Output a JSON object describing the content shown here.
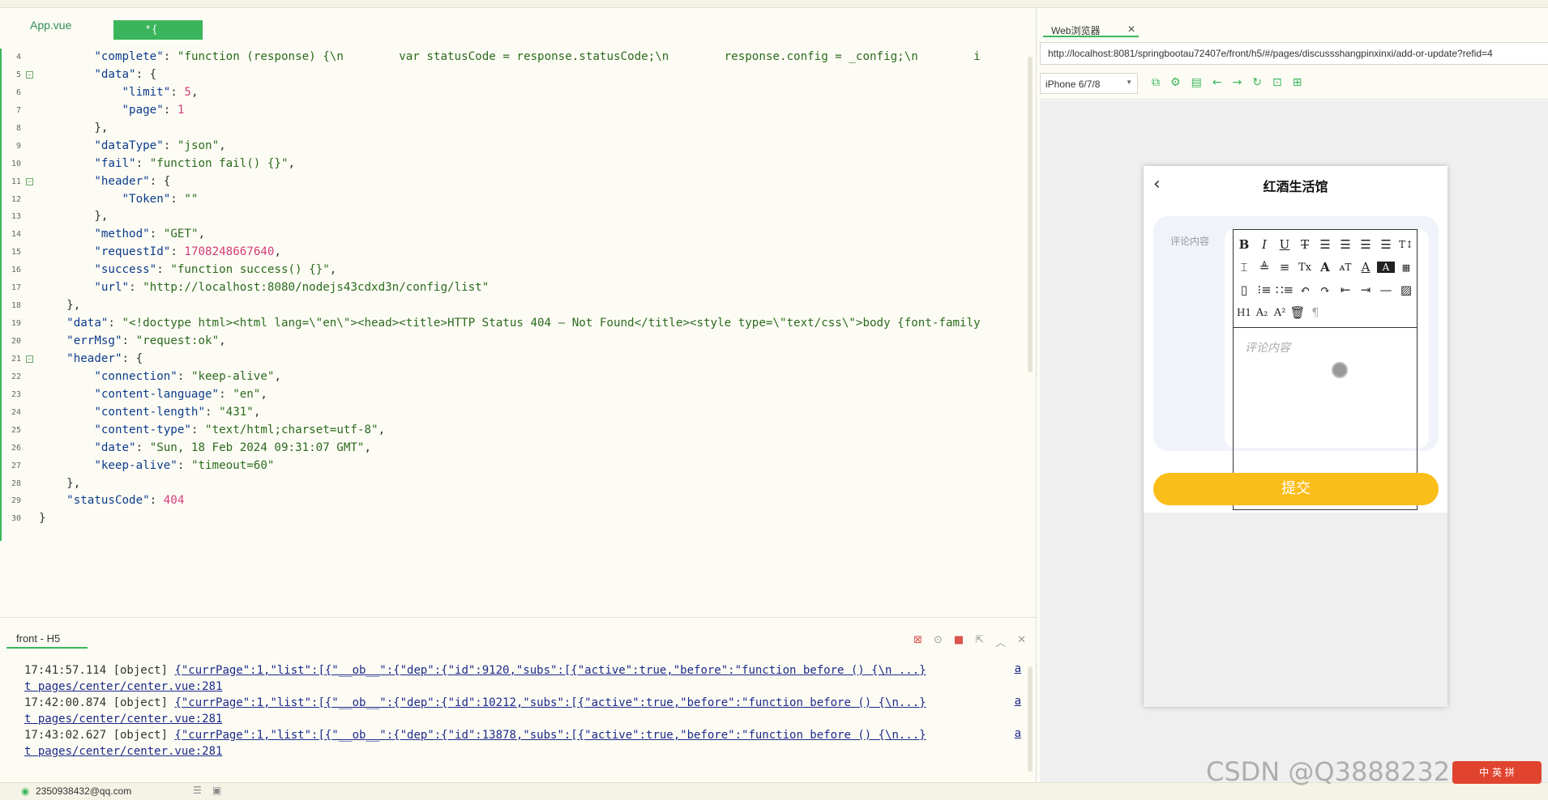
{
  "tabs": {
    "file1": "App.vue",
    "file2": "* {"
  },
  "code": [
    {
      "n": "4",
      "fold": false,
      "parts": [
        [
          "",
          "        "
        ],
        [
          "k",
          "\"complete\""
        ],
        [
          "",
          ": "
        ],
        [
          "s",
          "\"function (response) {\\n        var statusCode = response.statusCode;\\n        response.config = _config;\\n        i"
        ]
      ]
    },
    {
      "n": "5",
      "fold": true,
      "parts": [
        [
          "",
          "        "
        ],
        [
          "k",
          "\"data\""
        ],
        [
          "",
          ": {"
        ]
      ]
    },
    {
      "n": "6",
      "fold": false,
      "parts": [
        [
          "",
          "            "
        ],
        [
          "k",
          "\"limit\""
        ],
        [
          "",
          ": "
        ],
        [
          "n",
          "5"
        ],
        [
          "",
          ","
        ]
      ]
    },
    {
      "n": "7",
      "fold": false,
      "parts": [
        [
          "",
          "            "
        ],
        [
          "k",
          "\"page\""
        ],
        [
          "",
          ": "
        ],
        [
          "n",
          "1"
        ]
      ]
    },
    {
      "n": "8",
      "fold": false,
      "parts": [
        [
          "",
          "        },"
        ]
      ]
    },
    {
      "n": "9",
      "fold": false,
      "parts": [
        [
          "",
          "        "
        ],
        [
          "k",
          "\"dataType\""
        ],
        [
          "",
          ": "
        ],
        [
          "s",
          "\"json\""
        ],
        [
          "",
          ","
        ]
      ]
    },
    {
      "n": "10",
      "fold": false,
      "parts": [
        [
          "",
          "        "
        ],
        [
          "k",
          "\"fail\""
        ],
        [
          "",
          ": "
        ],
        [
          "s",
          "\"function fail() {}\""
        ],
        [
          "",
          ","
        ]
      ]
    },
    {
      "n": "11",
      "fold": true,
      "parts": [
        [
          "",
          "        "
        ],
        [
          "k",
          "\"header\""
        ],
        [
          "",
          ": {"
        ]
      ]
    },
    {
      "n": "12",
      "fold": false,
      "parts": [
        [
          "",
          "            "
        ],
        [
          "k",
          "\"Token\""
        ],
        [
          "",
          ": "
        ],
        [
          "s",
          "\"\""
        ]
      ]
    },
    {
      "n": "13",
      "fold": false,
      "parts": [
        [
          "",
          "        },"
        ]
      ]
    },
    {
      "n": "14",
      "fold": false,
      "parts": [
        [
          "",
          "        "
        ],
        [
          "k",
          "\"method\""
        ],
        [
          "",
          ": "
        ],
        [
          "s",
          "\"GET\""
        ],
        [
          "",
          ","
        ]
      ]
    },
    {
      "n": "15",
      "fold": false,
      "parts": [
        [
          "",
          "        "
        ],
        [
          "k",
          "\"requestId\""
        ],
        [
          "",
          ": "
        ],
        [
          "n",
          "1708248667640"
        ],
        [
          "",
          ","
        ]
      ]
    },
    {
      "n": "16",
      "fold": false,
      "parts": [
        [
          "",
          "        "
        ],
        [
          "k",
          "\"success\""
        ],
        [
          "",
          ": "
        ],
        [
          "s",
          "\"function success() {}\""
        ],
        [
          "",
          ","
        ]
      ]
    },
    {
      "n": "17",
      "fold": false,
      "parts": [
        [
          "",
          "        "
        ],
        [
          "k",
          "\"url\""
        ],
        [
          "",
          ": "
        ],
        [
          "s",
          "\"http://localhost:8080/nodejs43cdxd3n/config/list\""
        ]
      ]
    },
    {
      "n": "18",
      "fold": false,
      "parts": [
        [
          "",
          "    },"
        ]
      ]
    },
    {
      "n": "19",
      "fold": false,
      "parts": [
        [
          "",
          "    "
        ],
        [
          "k",
          "\"data\""
        ],
        [
          "",
          ": "
        ],
        [
          "s",
          "\"<!doctype html><html lang=\\\"en\\\"><head><title>HTTP Status 404 – Not Found</title><style type=\\\"text/css\\\">body {font-family"
        ]
      ]
    },
    {
      "n": "20",
      "fold": false,
      "parts": [
        [
          "",
          "    "
        ],
        [
          "k",
          "\"errMsg\""
        ],
        [
          "",
          ": "
        ],
        [
          "s",
          "\"request:ok\""
        ],
        [
          "",
          ","
        ]
      ]
    },
    {
      "n": "21",
      "fold": true,
      "parts": [
        [
          "",
          "    "
        ],
        [
          "k",
          "\"header\""
        ],
        [
          "",
          ": {"
        ]
      ]
    },
    {
      "n": "22",
      "fold": false,
      "parts": [
        [
          "",
          "        "
        ],
        [
          "k",
          "\"connection\""
        ],
        [
          "",
          ": "
        ],
        [
          "s",
          "\"keep-alive\""
        ],
        [
          "",
          ","
        ]
      ]
    },
    {
      "n": "23",
      "fold": false,
      "parts": [
        [
          "",
          "        "
        ],
        [
          "k",
          "\"content-language\""
        ],
        [
          "",
          ": "
        ],
        [
          "s",
          "\"en\""
        ],
        [
          "",
          ","
        ]
      ]
    },
    {
      "n": "24",
      "fold": false,
      "parts": [
        [
          "",
          "        "
        ],
        [
          "k",
          "\"content-length\""
        ],
        [
          "",
          ": "
        ],
        [
          "s",
          "\"431\""
        ],
        [
          "",
          ","
        ]
      ]
    },
    {
      "n": "25",
      "fold": false,
      "parts": [
        [
          "",
          "        "
        ],
        [
          "k",
          "\"content-type\""
        ],
        [
          "",
          ": "
        ],
        [
          "s",
          "\"text/html;charset=utf-8\""
        ],
        [
          "",
          ","
        ]
      ]
    },
    {
      "n": "26",
      "fold": false,
      "parts": [
        [
          "",
          "        "
        ],
        [
          "k",
          "\"date\""
        ],
        [
          "",
          ": "
        ],
        [
          "s",
          "\"Sun, 18 Feb 2024 09:31:07 GMT\""
        ],
        [
          "",
          ","
        ]
      ]
    },
    {
      "n": "27",
      "fold": false,
      "parts": [
        [
          "",
          "        "
        ],
        [
          "k",
          "\"keep-alive\""
        ],
        [
          "",
          ": "
        ],
        [
          "s",
          "\"timeout=60\""
        ]
      ]
    },
    {
      "n": "28",
      "fold": false,
      "parts": [
        [
          "",
          "    },"
        ]
      ]
    },
    {
      "n": "29",
      "fold": false,
      "parts": [
        [
          "",
          "    "
        ],
        [
          "k",
          "\"statusCode\""
        ],
        [
          "",
          ": "
        ],
        [
          "n",
          "404"
        ]
      ]
    },
    {
      "n": "30",
      "fold": false,
      "parts": [
        [
          "",
          "}"
        ]
      ]
    }
  ],
  "console": {
    "tab": "front - H5",
    "logs": [
      {
        "time": "17:41:57.114",
        "type": "[object]",
        "obj": "{\"currPage\":1,\"list\":[{\"__ob__\":{\"dep\":{\"id\":9120,\"subs\":[{\"active\":true,\"before\":\"function before () {\\n ...}",
        "at": "a",
        "loc": "t pages/center/center.vue:281"
      },
      {
        "time": "17:42:00.874",
        "type": "[object]",
        "obj": "{\"currPage\":1,\"list\":[{\"__ob__\":{\"dep\":{\"id\":10212,\"subs\":[{\"active\":true,\"before\":\"function before () {\\n...}",
        "at": "a",
        "loc": "t pages/center/center.vue:281"
      },
      {
        "time": "17:43:02.627",
        "type": "[object]",
        "obj": "{\"currPage\":1,\"list\":[{\"__ob__\":{\"dep\":{\"id\":13878,\"subs\":[{\"active\":true,\"before\":\"function before () {\\n...}",
        "at": "a",
        "loc": "t pages/center/center.vue:281"
      }
    ]
  },
  "status": {
    "user": "2350938432@qq.com"
  },
  "browser": {
    "tab": "Web浏览器",
    "url": "http://localhost:8081/springbootau72407e/front/h5/#/pages/discussshangpinxinxi/add-or-update?refid=4",
    "device": "iPhone 6/7/8"
  },
  "phone": {
    "title": "红酒生活馆",
    "field_label": "评论内容",
    "placeholder": "评论内容",
    "submit": "提交"
  },
  "watermark": "CSDN @Q3888232316",
  "badge": "中 英 拼"
}
